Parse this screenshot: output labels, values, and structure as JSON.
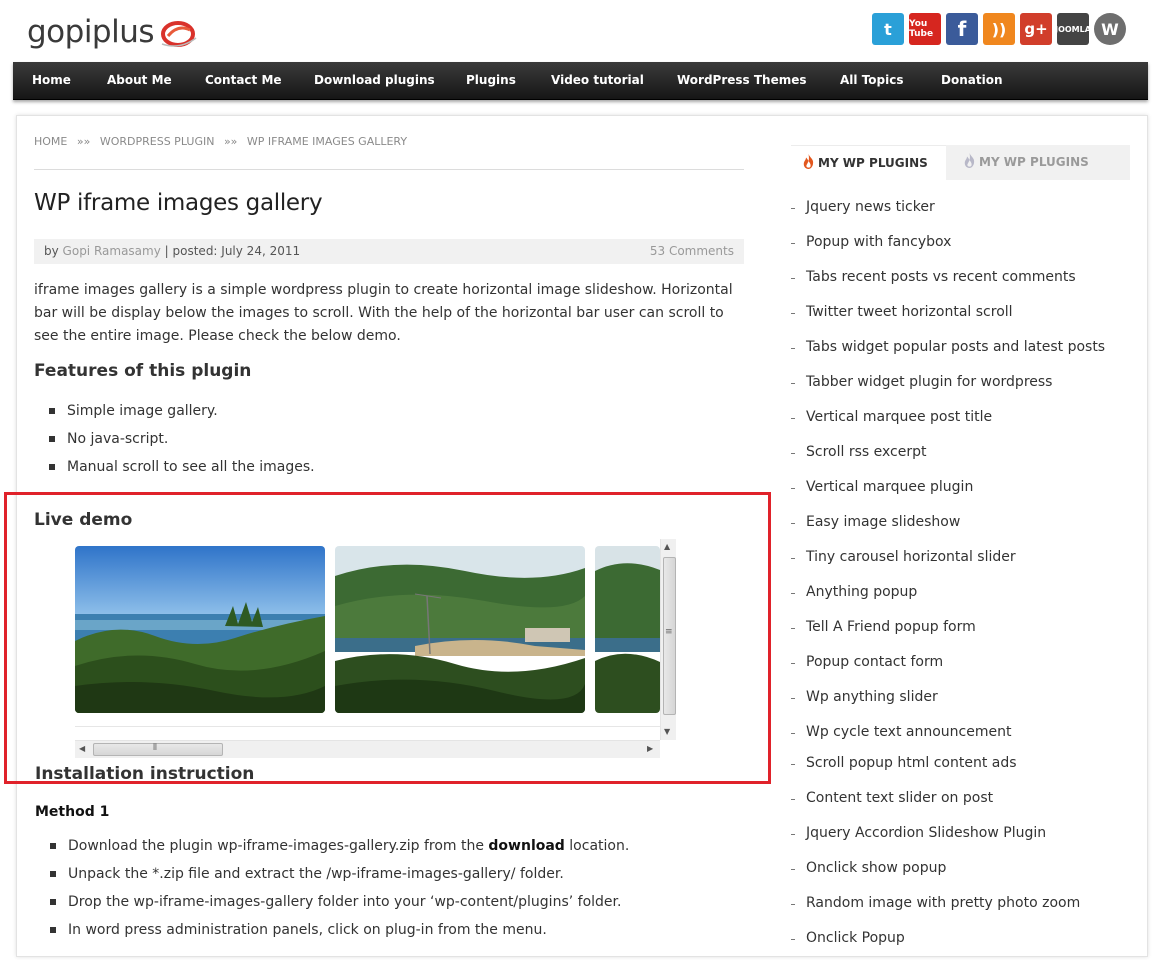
{
  "header": {
    "logo_text": "gopiplus",
    "social": [
      {
        "icon": "twitter-icon",
        "glyph": "t",
        "color": "#2aa0d8"
      },
      {
        "icon": "youtube-icon",
        "glyph": "You Tube",
        "color": "#d6261f"
      },
      {
        "icon": "facebook-icon",
        "glyph": "f",
        "color": "#3b5b9a"
      },
      {
        "icon": "rss-icon",
        "glyph": "))",
        "color": "#f0871e"
      },
      {
        "icon": "google-plus-icon",
        "glyph": "g+",
        "color": "#d13e2b"
      },
      {
        "icon": "joomla-icon",
        "glyph": "JOOMLA",
        "color": "#444444"
      },
      {
        "icon": "wordpress-icon",
        "glyph": "W",
        "color": "#6e6e6e"
      }
    ]
  },
  "nav": {
    "items": [
      "Home",
      "About Me",
      "Contact Me",
      "Download plugins",
      "Plugins",
      "Video tutorial",
      "WordPress Themes",
      "All Topics",
      "Donation"
    ]
  },
  "breadcrumb": {
    "home": "HOME",
    "sep1": "»»",
    "category": "WORDPRESS PLUGIN",
    "sep2": "»»",
    "current": "WP IFRAME IMAGES GALLERY"
  },
  "post": {
    "title": "WP iframe images gallery",
    "meta_by": "by",
    "author": "Gopi Ramasamy",
    "meta_posted": "| posted: July 24, 2011",
    "comments": "53 Comments",
    "intro": "iframe images gallery is a simple wordpress plugin to create horizontal image slideshow. Horizontal bar will be display below the images to scroll. With the help of the horizontal bar user can scroll to see the entire image. Please check the below demo.",
    "features_heading": "Features of this plugin",
    "features": [
      "Simple image gallery.",
      "No java-script.",
      "Manual scroll to see all the images."
    ],
    "demo_heading": "Live demo",
    "install_heading": "Installation instruction",
    "method_heading": "Method 1",
    "steps": [
      {
        "pre": "Download the plugin wp-iframe-images-gallery.zip from the ",
        "bold": "download",
        "post": " location."
      },
      {
        "pre": "Unpack the *.zip file and extract the /wp-iframe-images-gallery/ folder.",
        "bold": "",
        "post": ""
      },
      {
        "pre": "Drop the wp-iframe-images-gallery folder into your ‘wp-content/plugins’ folder.",
        "bold": "",
        "post": ""
      },
      {
        "pre": "In word press administration panels, click on plug-in from the menu.",
        "bold": "",
        "post": ""
      }
    ]
  },
  "sidebar": {
    "tab_active": "MY WP PLUGINS",
    "tab_inactive": "MY WP PLUGINS",
    "items": [
      "Jquery news ticker",
      "Popup with fancybox",
      "Tabs recent posts vs recent comments",
      "Twitter tweet horizontal scroll",
      "Tabs widget popular posts and latest posts",
      "Tabber widget plugin for wordpress",
      "Vertical marquee post title",
      "Scroll rss excerpt",
      "Vertical marquee plugin",
      "Easy image slideshow",
      "Tiny carousel horizontal slider",
      "Anything popup",
      "Tell A Friend popup form",
      "Popup contact form",
      "Wp anything slider",
      "Wp cycle text announcement",
      "Scroll popup html content ads",
      "Content text slider on post",
      "Jquery Accordion Slideshow Plugin",
      "Onclick show popup",
      "Random image with pretty photo zoom",
      "Onclick Popup"
    ]
  },
  "colors": {
    "highlight_box": "#e0222a",
    "nav_bg": "#222222",
    "link_muted": "#999999"
  }
}
